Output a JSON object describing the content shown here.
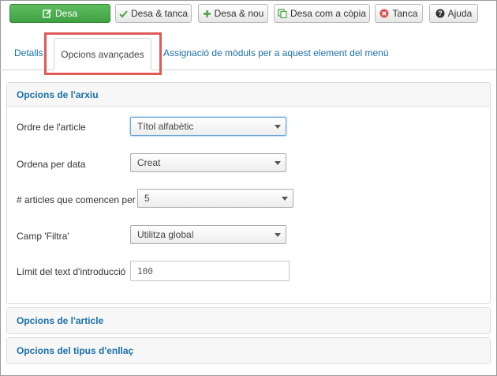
{
  "toolbar": {
    "save": {
      "label": "Desa",
      "icon": "edit-icon"
    },
    "save_close": {
      "label": "Desa & tanca",
      "icon": "check-icon"
    },
    "save_new": {
      "label": "Desa & nou",
      "icon": "plus-icon"
    },
    "save_copy": {
      "label": "Desa com a còpia",
      "icon": "copy-icon"
    },
    "cancel": {
      "label": "Tanca",
      "icon": "cancel-circle-icon"
    },
    "help": {
      "label": "Ajuda",
      "icon": "question-circle-icon"
    }
  },
  "tabs": [
    {
      "label": "Detalls",
      "active": false
    },
    {
      "label": "Opcions avançades",
      "active": true
    },
    {
      "label": "Assignació de mòduls per a aquest element del menú",
      "active": false
    }
  ],
  "sections": {
    "archive": {
      "title": "Opcions de l'arxiu",
      "fields": {
        "order": {
          "label": "Ordre de l'article",
          "value": "Títol alfabètic"
        },
        "date_order": {
          "label": "Ordena per data",
          "value": "Creat"
        },
        "num_articles": {
          "label": "# articles que comencen per",
          "value": "5"
        },
        "filter_field": {
          "label": "Camp 'Filtra'",
          "value": "Utilitza global"
        },
        "intro_limit": {
          "label": "Límit del text d'introducció",
          "value": "100"
        }
      }
    },
    "article": {
      "title": "Opcions de l'article"
    },
    "link_type": {
      "title": "Opcions del tipus d'enllaç"
    }
  },
  "colors": {
    "primary": "#46a546",
    "link": "#1a6fa8",
    "highlight": "#e05a57",
    "cancel": "#d9534f"
  }
}
